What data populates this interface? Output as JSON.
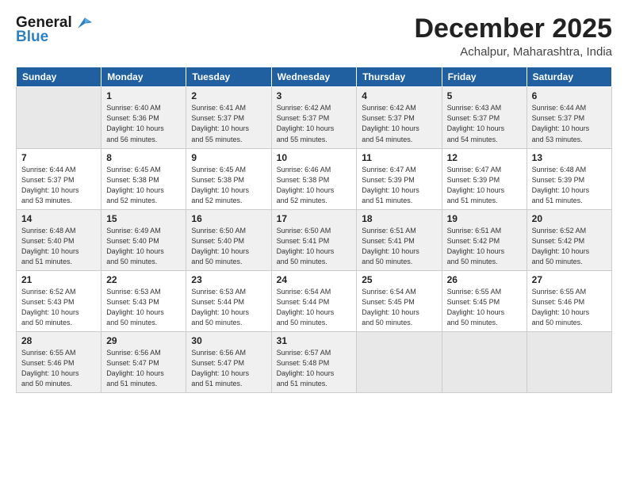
{
  "header": {
    "logo_line1": "General",
    "logo_line2": "Blue",
    "month": "December 2025",
    "location": "Achalpur, Maharashtra, India"
  },
  "weekdays": [
    "Sunday",
    "Monday",
    "Tuesday",
    "Wednesday",
    "Thursday",
    "Friday",
    "Saturday"
  ],
  "weeks": [
    [
      {
        "day": "",
        "info": ""
      },
      {
        "day": "1",
        "info": "Sunrise: 6:40 AM\nSunset: 5:36 PM\nDaylight: 10 hours\nand 56 minutes."
      },
      {
        "day": "2",
        "info": "Sunrise: 6:41 AM\nSunset: 5:37 PM\nDaylight: 10 hours\nand 55 minutes."
      },
      {
        "day": "3",
        "info": "Sunrise: 6:42 AM\nSunset: 5:37 PM\nDaylight: 10 hours\nand 55 minutes."
      },
      {
        "day": "4",
        "info": "Sunrise: 6:42 AM\nSunset: 5:37 PM\nDaylight: 10 hours\nand 54 minutes."
      },
      {
        "day": "5",
        "info": "Sunrise: 6:43 AM\nSunset: 5:37 PM\nDaylight: 10 hours\nand 54 minutes."
      },
      {
        "day": "6",
        "info": "Sunrise: 6:44 AM\nSunset: 5:37 PM\nDaylight: 10 hours\nand 53 minutes."
      }
    ],
    [
      {
        "day": "7",
        "info": "Sunrise: 6:44 AM\nSunset: 5:37 PM\nDaylight: 10 hours\nand 53 minutes."
      },
      {
        "day": "8",
        "info": "Sunrise: 6:45 AM\nSunset: 5:38 PM\nDaylight: 10 hours\nand 52 minutes."
      },
      {
        "day": "9",
        "info": "Sunrise: 6:45 AM\nSunset: 5:38 PM\nDaylight: 10 hours\nand 52 minutes."
      },
      {
        "day": "10",
        "info": "Sunrise: 6:46 AM\nSunset: 5:38 PM\nDaylight: 10 hours\nand 52 minutes."
      },
      {
        "day": "11",
        "info": "Sunrise: 6:47 AM\nSunset: 5:39 PM\nDaylight: 10 hours\nand 51 minutes."
      },
      {
        "day": "12",
        "info": "Sunrise: 6:47 AM\nSunset: 5:39 PM\nDaylight: 10 hours\nand 51 minutes."
      },
      {
        "day": "13",
        "info": "Sunrise: 6:48 AM\nSunset: 5:39 PM\nDaylight: 10 hours\nand 51 minutes."
      }
    ],
    [
      {
        "day": "14",
        "info": "Sunrise: 6:48 AM\nSunset: 5:40 PM\nDaylight: 10 hours\nand 51 minutes."
      },
      {
        "day": "15",
        "info": "Sunrise: 6:49 AM\nSunset: 5:40 PM\nDaylight: 10 hours\nand 50 minutes."
      },
      {
        "day": "16",
        "info": "Sunrise: 6:50 AM\nSunset: 5:40 PM\nDaylight: 10 hours\nand 50 minutes."
      },
      {
        "day": "17",
        "info": "Sunrise: 6:50 AM\nSunset: 5:41 PM\nDaylight: 10 hours\nand 50 minutes."
      },
      {
        "day": "18",
        "info": "Sunrise: 6:51 AM\nSunset: 5:41 PM\nDaylight: 10 hours\nand 50 minutes."
      },
      {
        "day": "19",
        "info": "Sunrise: 6:51 AM\nSunset: 5:42 PM\nDaylight: 10 hours\nand 50 minutes."
      },
      {
        "day": "20",
        "info": "Sunrise: 6:52 AM\nSunset: 5:42 PM\nDaylight: 10 hours\nand 50 minutes."
      }
    ],
    [
      {
        "day": "21",
        "info": "Sunrise: 6:52 AM\nSunset: 5:43 PM\nDaylight: 10 hours\nand 50 minutes."
      },
      {
        "day": "22",
        "info": "Sunrise: 6:53 AM\nSunset: 5:43 PM\nDaylight: 10 hours\nand 50 minutes."
      },
      {
        "day": "23",
        "info": "Sunrise: 6:53 AM\nSunset: 5:44 PM\nDaylight: 10 hours\nand 50 minutes."
      },
      {
        "day": "24",
        "info": "Sunrise: 6:54 AM\nSunset: 5:44 PM\nDaylight: 10 hours\nand 50 minutes."
      },
      {
        "day": "25",
        "info": "Sunrise: 6:54 AM\nSunset: 5:45 PM\nDaylight: 10 hours\nand 50 minutes."
      },
      {
        "day": "26",
        "info": "Sunrise: 6:55 AM\nSunset: 5:45 PM\nDaylight: 10 hours\nand 50 minutes."
      },
      {
        "day": "27",
        "info": "Sunrise: 6:55 AM\nSunset: 5:46 PM\nDaylight: 10 hours\nand 50 minutes."
      }
    ],
    [
      {
        "day": "28",
        "info": "Sunrise: 6:55 AM\nSunset: 5:46 PM\nDaylight: 10 hours\nand 50 minutes."
      },
      {
        "day": "29",
        "info": "Sunrise: 6:56 AM\nSunset: 5:47 PM\nDaylight: 10 hours\nand 51 minutes."
      },
      {
        "day": "30",
        "info": "Sunrise: 6:56 AM\nSunset: 5:47 PM\nDaylight: 10 hours\nand 51 minutes."
      },
      {
        "day": "31",
        "info": "Sunrise: 6:57 AM\nSunset: 5:48 PM\nDaylight: 10 hours\nand 51 minutes."
      },
      {
        "day": "",
        "info": ""
      },
      {
        "day": "",
        "info": ""
      },
      {
        "day": "",
        "info": ""
      }
    ]
  ]
}
